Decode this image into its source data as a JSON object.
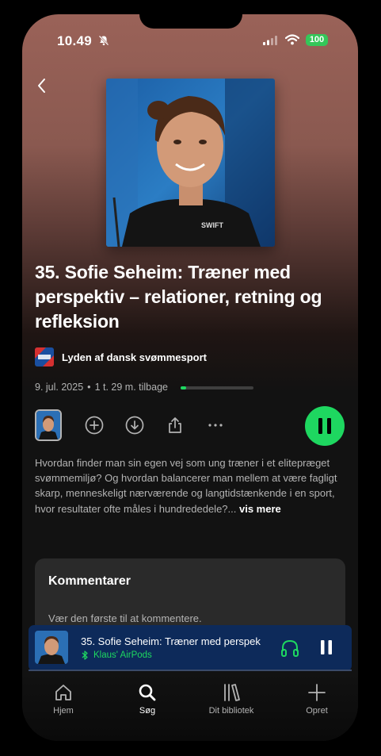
{
  "status_bar": {
    "time": "10.49",
    "battery": "100"
  },
  "episode": {
    "title": "35. Sofie Seheim: Træner med perspektiv – relationer, retning og refleksion",
    "show_name": "Lyden af dansk svømmesport",
    "date": "9. jul. 2025",
    "separator": "•",
    "time_left": "1 t. 29 m. tilbage",
    "progress_fraction": 0.08,
    "description": "Hvordan finder man sin egen vej som ung træner i et eliteprægет svømmemiljø? Og hvordan balancerer man mellem at være fagligt skarp, menneskeligt nærværende og langtidstænkende i en sport, hvor resultater ofte måles i hundrededele?...",
    "more_label": "vis mere"
  },
  "comments": {
    "title": "Kommentarer",
    "empty_text": "Vær den første til at kommentere."
  },
  "mini_player": {
    "title": "35. Sofie Seheim: Træner med perspek",
    "device": "Klaus' AirPods"
  },
  "nav": {
    "home": "Hjem",
    "search": "Søg",
    "library": "Dit bibliotek",
    "create": "Opret"
  },
  "colors": {
    "accent": "#1ed760",
    "header_bg": "#9a6258",
    "mini_player_bg": "#0d2a5a",
    "surface": "#2a2a2a"
  },
  "icons": [
    "bell-slash-icon",
    "signal-icon",
    "wifi-icon",
    "battery-icon",
    "chevron-left-icon",
    "add-circle-icon",
    "download-icon",
    "share-icon",
    "more-icon",
    "pause-icon",
    "bluetooth-icon",
    "headphones-icon",
    "home-icon",
    "search-icon",
    "library-icon",
    "plus-icon"
  ]
}
